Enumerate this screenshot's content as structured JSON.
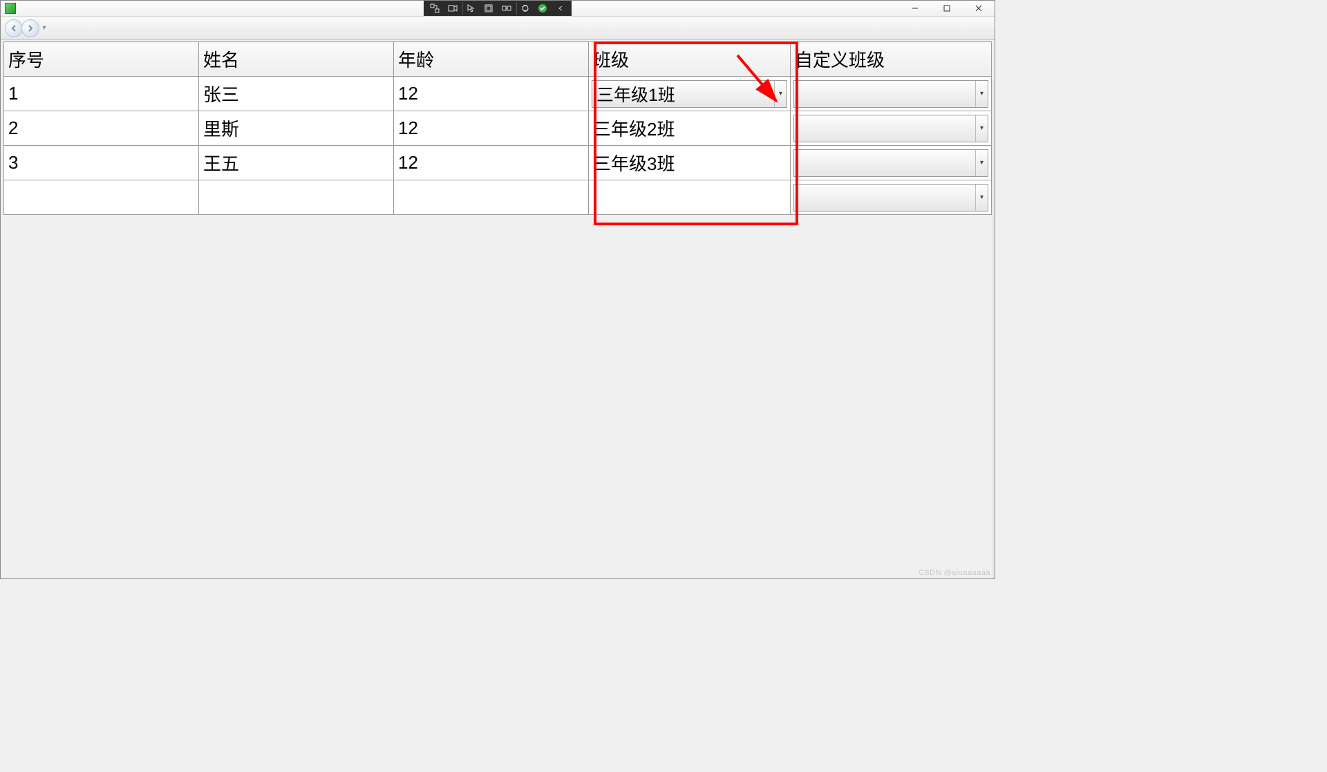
{
  "window": {
    "title": ""
  },
  "toolbar": {
    "dev_buttons": [
      "live-tree",
      "record",
      "select",
      "layout",
      "sync",
      "refresh",
      "ok",
      "collapse"
    ]
  },
  "nav": {
    "back": "◄",
    "forward": "►"
  },
  "table": {
    "headers": {
      "index": "序号",
      "name": "姓名",
      "age": "年龄",
      "class": "班级",
      "custom_class": "自定义班级"
    },
    "rows": [
      {
        "index": "1",
        "name": "张三",
        "age": "12",
        "class": "三年级1班",
        "custom": "",
        "class_is_combo": true
      },
      {
        "index": "2",
        "name": "里斯",
        "age": "12",
        "class": "三年级2班",
        "custom": "",
        "class_is_combo": false
      },
      {
        "index": "3",
        "name": "王五",
        "age": "12",
        "class": "三年级3班",
        "custom": "",
        "class_is_combo": false
      },
      {
        "index": "",
        "name": "",
        "age": "",
        "class": "",
        "custom": "",
        "class_is_combo": false
      }
    ]
  },
  "watermark": "CSDN @qiuaaaaaa"
}
